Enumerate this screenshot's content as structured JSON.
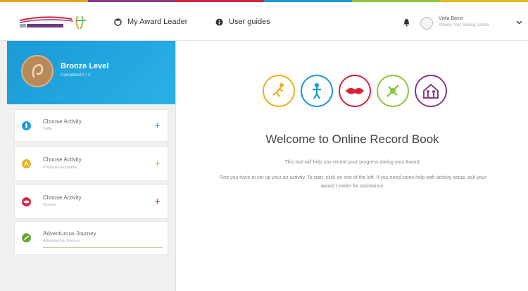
{
  "colors": {
    "strip": [
      "#e8a41c",
      "#8a3a8c",
      "#d6243c",
      "#1a9ad6",
      "#8cc63f",
      "#e3b81c"
    ],
    "card_blue": "#1a9ad6",
    "skills": "#1a9ad6",
    "physical": "#e8b11c",
    "service": "#d6243c",
    "adventure": "#6aa532",
    "residential": "#8a3a8c"
  },
  "header": {
    "logo_icon": "award-logo",
    "nav": [
      {
        "icon": "award-leader-icon",
        "label": "My Award Leader"
      },
      {
        "icon": "info-icon",
        "label": "User guides"
      }
    ],
    "bell_icon": "bell-icon",
    "user": {
      "name": "Viola Bavis",
      "center": "Albany Park Sailing Centre"
    },
    "chevron_icon": "chevron-down-icon"
  },
  "level": {
    "title": "Bronze Level",
    "subtitle": "Completed 0 / 3"
  },
  "activities": [
    {
      "label": "Choose Activity",
      "sub": "Skills",
      "icon": "skills-icon",
      "color_key": "skills"
    },
    {
      "label": "Choose Activity",
      "sub": "Physical Recreation",
      "icon": "physical-icon",
      "color_key": "physical"
    },
    {
      "label": "Choose Activity",
      "sub": "Service",
      "icon": "service-icon",
      "color_key": "service"
    },
    {
      "label": "Adventurous Journey",
      "sub": "Adventurous Journey",
      "icon": "adventure-icon",
      "color_key": "adventure"
    }
  ],
  "main": {
    "section_icons": [
      "physical-icon",
      "skills-icon",
      "service-icon",
      "adventure-icon",
      "residential-icon"
    ],
    "welcome": "Welcome to Online Record Book",
    "intro": "This tool will help you record your progress during your Award.",
    "help": "First you have to set up your an activity. To start, click on one of the left. If you need some help with activity setup, ask your Award Leader for assistance."
  }
}
